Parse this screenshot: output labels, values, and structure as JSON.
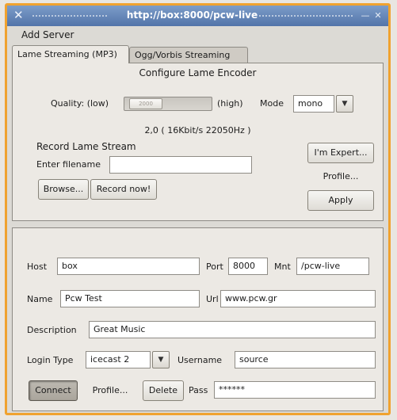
{
  "window": {
    "title": "http://box:8000/pcw-live"
  },
  "menu": {
    "add_server": "Add Server"
  },
  "tabs": [
    {
      "label": "Lame Streaming (MP3)",
      "active": true
    },
    {
      "label": "Ogg/Vorbis Streaming",
      "active": false
    }
  ],
  "encoder": {
    "heading": "Configure Lame Encoder",
    "quality_low": "Quality: (low)",
    "quality_high": "(high)",
    "quality_handle": "2000",
    "mode_label": "Mode",
    "mode_value": "mono",
    "bitrate_info": "2,0 ( 16Kbit/s 22050Hz )",
    "record_heading": "Record Lame Stream",
    "filename_label": "Enter filename",
    "filename_value": "",
    "browse_label": "Browse...",
    "record_label": "Record now!",
    "expert_label": "I'm Expert...",
    "profile_label": "Profile...",
    "apply_label": "Apply"
  },
  "server": {
    "host_label": "Host",
    "host_value": "box",
    "port_label": "Port",
    "port_value": "8000",
    "mnt_label": "Mnt",
    "mnt_value": "/pcw-live",
    "name_label": "Name",
    "name_value": "Pcw Test",
    "url_label": "Url",
    "url_value": "www.pcw.gr",
    "description_label": "Description",
    "description_value": "Great Music",
    "login_type_label": "Login Type",
    "login_type_value": "icecast 2",
    "username_label": "Username",
    "username_value": "source",
    "connect_label": "Connect",
    "profile_label": "Profile...",
    "delete_label": "Delete",
    "pass_label": "Pass",
    "pass_value": "******"
  },
  "colors": {
    "titlebar": "#5274a9",
    "frame_border": "#f0a22f",
    "window_bg": "#dcdad5"
  }
}
